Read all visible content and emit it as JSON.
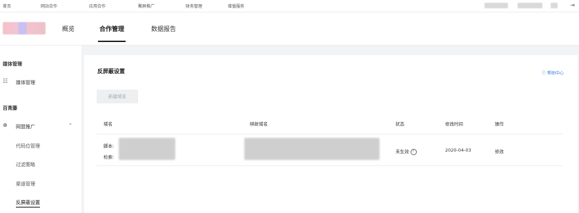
{
  "topnav": {
    "items": [
      "首页",
      "网站合作",
      "应用合作",
      "聚屏推广",
      "财务管理",
      "增值服务"
    ]
  },
  "header": {
    "tabs": [
      "概览",
      "合作管理",
      "数据报告"
    ],
    "active_tab": "合作管理"
  },
  "sidebar": {
    "section_media": "媒体管理",
    "item_media": "媒体管理",
    "section_baiqingteng": "百青藤",
    "item_alliance": "网盟推广",
    "sub_items": [
      "代码位管理",
      "过滤策略",
      "渠道管理",
      "反屏蔽设置"
    ],
    "active_sub": "反屏蔽设置"
  },
  "main": {
    "title": "反屏蔽设置",
    "help_link": "帮助中心",
    "new_domain_button": "新建域名",
    "table": {
      "headers": [
        "域名",
        "映射域名",
        "状态",
        "修改时间",
        "操作"
      ],
      "rows": [
        {
          "domain_line1_label": "脚本:",
          "domain_line2_label": "检索:",
          "status": "未生效",
          "modified": "2020-04-03",
          "action": "修改"
        }
      ]
    }
  },
  "colors": {
    "accent": "#3b7bd9",
    "background": "#f2f3f5"
  }
}
